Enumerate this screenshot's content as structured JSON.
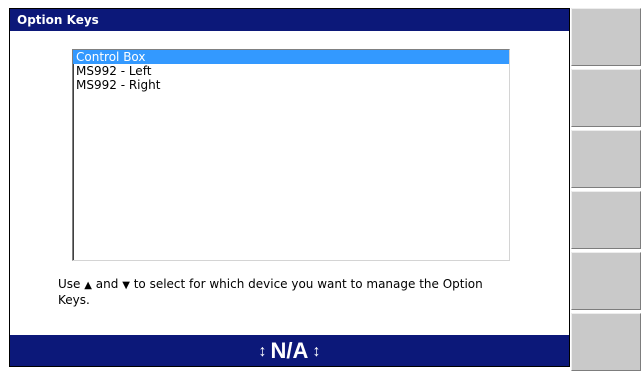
{
  "window": {
    "title": "Option Keys"
  },
  "device_list": {
    "items": [
      "Control Box",
      "MS992 - Left",
      "MS992 - Right"
    ],
    "selected_index": 0
  },
  "instructions": {
    "prefix": "Use",
    "up_arrow": "▲",
    "and": "and",
    "down_arrow": "▼",
    "suffix": "to select for which device you want to manage the Option Keys."
  },
  "status": {
    "value": "N/A",
    "left_glyph": "↕",
    "right_glyph": "↕"
  },
  "softkeys": {
    "count": 6,
    "labels": [
      "",
      "",
      "",
      "",
      "",
      ""
    ]
  },
  "colors": {
    "titlebar": "#0c1879",
    "selection": "#3399ff",
    "softkey": "#c9c9c9"
  }
}
